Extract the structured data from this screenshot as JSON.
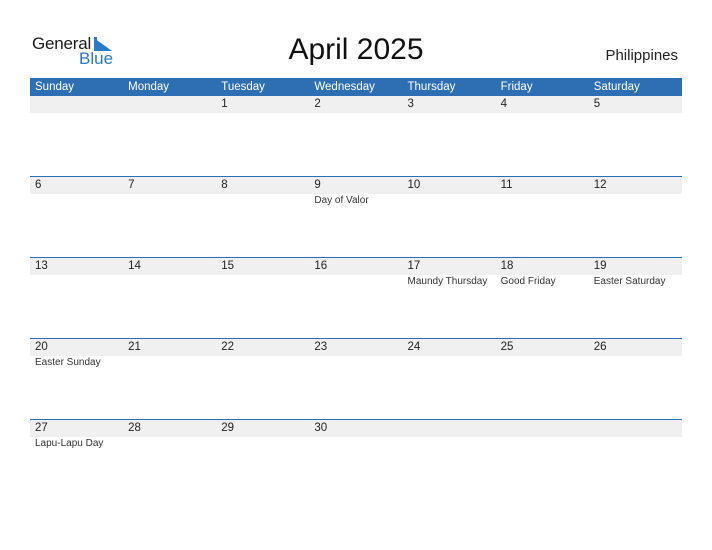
{
  "logo": {
    "general": "General",
    "blue": "Blue"
  },
  "title": "April 2025",
  "country": "Philippines",
  "colors": {
    "header_bg": "#2e6fb3",
    "date_strip": "#f0f0f0",
    "brand_blue": "#2a7ac4"
  },
  "weekdays": [
    "Sunday",
    "Monday",
    "Tuesday",
    "Wednesday",
    "Thursday",
    "Friday",
    "Saturday"
  ],
  "weeks": [
    [
      {
        "day": "",
        "holiday": ""
      },
      {
        "day": "",
        "holiday": ""
      },
      {
        "day": "1",
        "holiday": ""
      },
      {
        "day": "2",
        "holiday": ""
      },
      {
        "day": "3",
        "holiday": ""
      },
      {
        "day": "4",
        "holiday": ""
      },
      {
        "day": "5",
        "holiday": ""
      }
    ],
    [
      {
        "day": "6",
        "holiday": ""
      },
      {
        "day": "7",
        "holiday": ""
      },
      {
        "day": "8",
        "holiday": ""
      },
      {
        "day": "9",
        "holiday": "Day of Valor"
      },
      {
        "day": "10",
        "holiday": ""
      },
      {
        "day": "11",
        "holiday": ""
      },
      {
        "day": "12",
        "holiday": ""
      }
    ],
    [
      {
        "day": "13",
        "holiday": ""
      },
      {
        "day": "14",
        "holiday": ""
      },
      {
        "day": "15",
        "holiday": ""
      },
      {
        "day": "16",
        "holiday": ""
      },
      {
        "day": "17",
        "holiday": "Maundy Thursday"
      },
      {
        "day": "18",
        "holiday": "Good Friday"
      },
      {
        "day": "19",
        "holiday": "Easter Saturday"
      }
    ],
    [
      {
        "day": "20",
        "holiday": "Easter Sunday"
      },
      {
        "day": "21",
        "holiday": ""
      },
      {
        "day": "22",
        "holiday": ""
      },
      {
        "day": "23",
        "holiday": ""
      },
      {
        "day": "24",
        "holiday": ""
      },
      {
        "day": "25",
        "holiday": ""
      },
      {
        "day": "26",
        "holiday": ""
      }
    ],
    [
      {
        "day": "27",
        "holiday": "Lapu-Lapu Day"
      },
      {
        "day": "28",
        "holiday": ""
      },
      {
        "day": "29",
        "holiday": ""
      },
      {
        "day": "30",
        "holiday": ""
      },
      {
        "day": "",
        "holiday": ""
      },
      {
        "day": "",
        "holiday": ""
      },
      {
        "day": "",
        "holiday": ""
      }
    ]
  ]
}
